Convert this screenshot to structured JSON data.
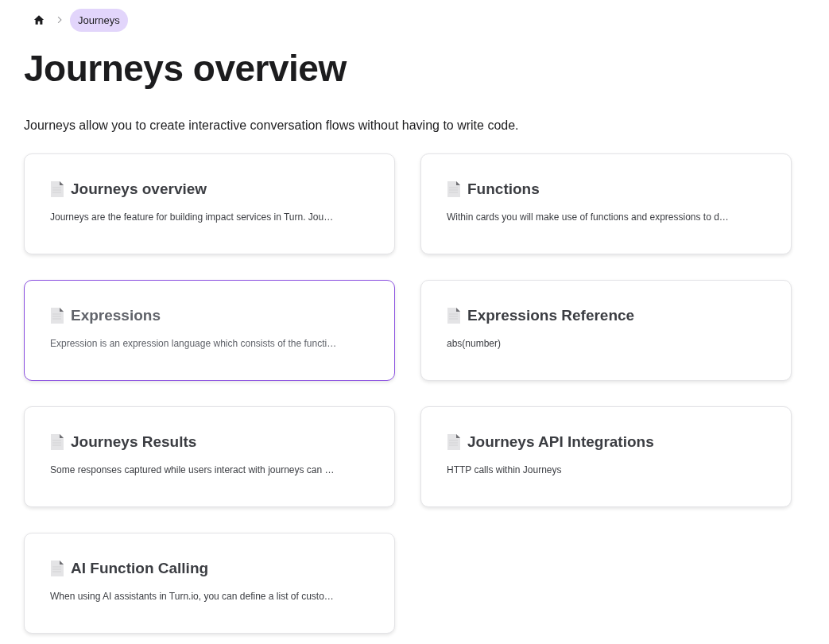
{
  "breadcrumb": {
    "items": [
      {
        "label": "Journeys",
        "selected": true
      }
    ]
  },
  "title": "Journeys overview",
  "description": "Journeys allow you to create interactive conversation flows without having to write code.",
  "cards": [
    {
      "title": "Journeys overview",
      "summary": "Journeys are the feature for building impact services in Turn. Jou…",
      "hovered": false
    },
    {
      "title": "Functions",
      "summary": "Within cards you will make use of functions and expressions to d…",
      "hovered": false
    },
    {
      "title": "Expressions",
      "summary": "Expression is an expression language which consists of the functi…",
      "hovered": true
    },
    {
      "title": "Expressions Reference",
      "summary": "abs(number)",
      "hovered": false
    },
    {
      "title": "Journeys Results",
      "summary": "Some responses captured while users interact with journeys can …",
      "hovered": false
    },
    {
      "title": "Journeys API Integrations",
      "summary": "HTTP calls within Journeys",
      "hovered": false
    },
    {
      "title": "AI Function Calling",
      "summary": "When using AI assistants in Turn.io, you can define a list of custo…",
      "hovered": false
    }
  ]
}
